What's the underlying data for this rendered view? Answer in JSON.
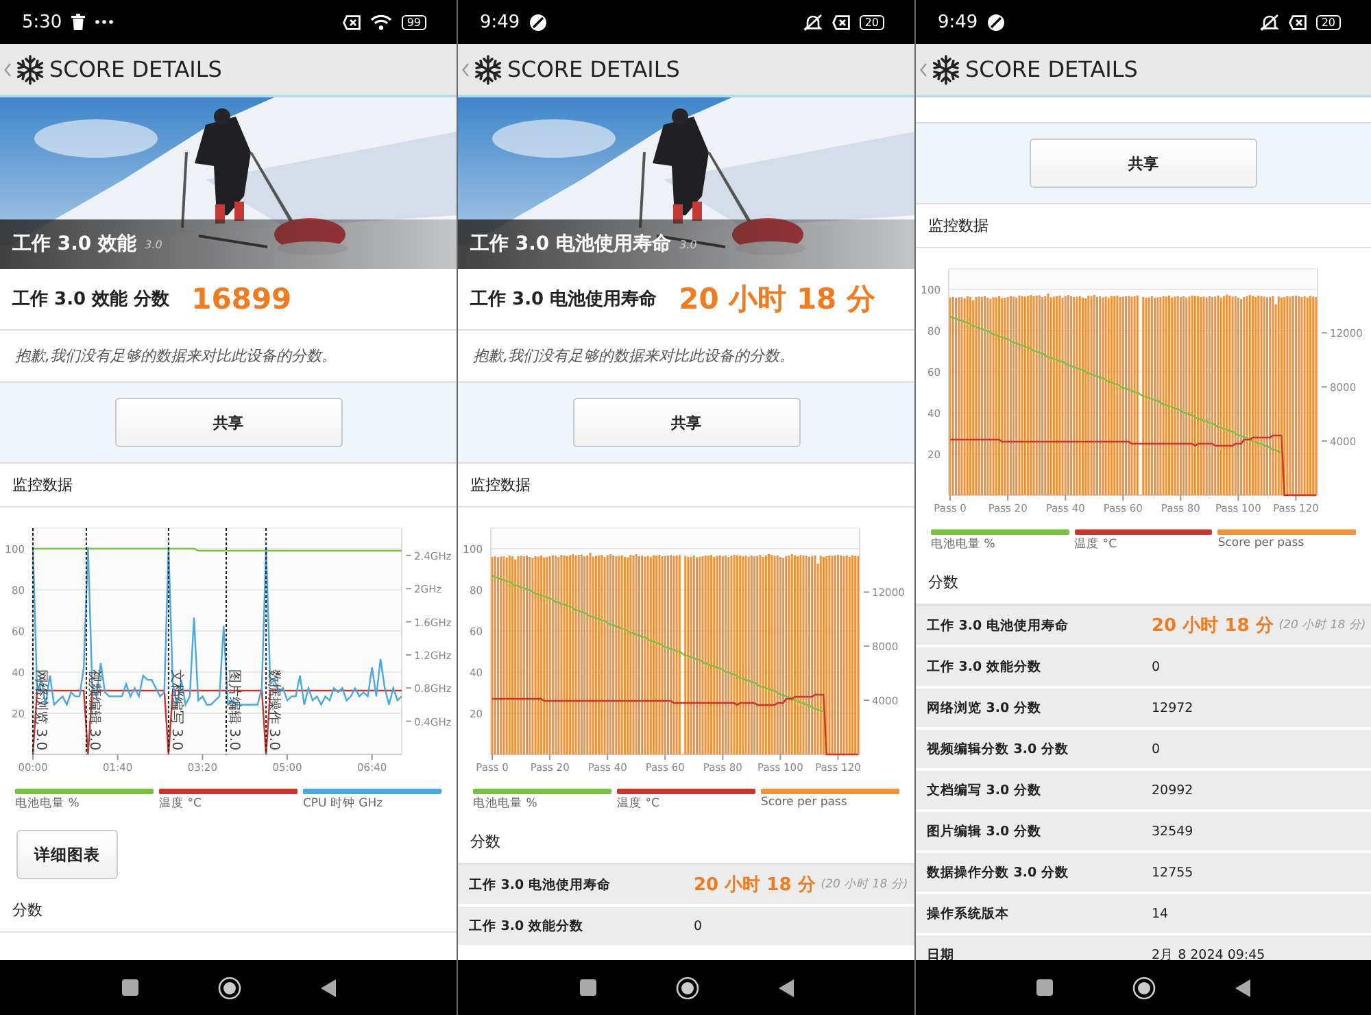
{
  "screens": [
    {
      "status_bar": {
        "time": "5:30",
        "battery": "99",
        "left_icons": [
          {
            "kind": "trash"
          },
          {
            "kind": "more"
          }
        ],
        "right_icons": [
          {
            "kind": "x-box"
          },
          {
            "kind": "wifi"
          }
        ]
      },
      "title": "SCORE DETAILS",
      "scrolled": false,
      "sections": [
        {
          "kind": "hero",
          "title": "工作 3.0 效能",
          "version": "3.0"
        },
        {
          "kind": "score",
          "label": "工作 3.0 效能 分数",
          "value": "16899"
        },
        {
          "kind": "note",
          "text": "抱歉,我们没有足够的数据来对比此设备的分数。"
        },
        {
          "kind": "share",
          "label": "共享"
        },
        {
          "kind": "heading",
          "text": "监控数据"
        },
        {
          "kind": "chart",
          "chart_data": {
            "type": "line",
            "grid": true,
            "xlim": [
              0,
              435
            ],
            "ylim": [
              0,
              110
            ],
            "y2lim": [
              0,
              2.73
            ],
            "x": [
              0,
              5,
              10,
              15,
              20,
              25,
              30,
              35,
              40,
              45,
              50,
              55,
              60,
              65,
              70,
              75,
              80,
              85,
              90,
              95,
              100,
              105,
              110,
              115,
              120,
              125,
              130,
              135,
              140,
              145,
              150,
              155,
              160,
              165,
              170,
              175,
              180,
              185,
              190,
              195,
              200,
              205,
              210,
              215,
              220,
              225,
              230,
              235,
              240,
              245,
              250,
              255,
              260,
              265,
              270,
              275,
              280,
              285,
              290,
              295,
              300,
              305,
              310,
              315,
              320,
              325,
              330,
              335,
              340,
              345,
              350,
              355,
              360,
              365,
              370,
              375,
              380,
              385,
              390,
              395,
              400,
              405,
              410,
              415,
              420,
              425,
              430,
              435
            ],
            "xticks": [
              {
                "value": 0,
                "label": "00:00"
              },
              {
                "value": 100,
                "label": "01:40"
              },
              {
                "value": 200,
                "label": "03:20"
              },
              {
                "value": 300,
                "label": "05:00"
              },
              {
                "value": 400,
                "label": "06:40"
              }
            ],
            "yticks": [
              20,
              40,
              60,
              80,
              100
            ],
            "y2ticks": [
              {
                "value": 0.4,
                "label": "0.4GHz"
              },
              {
                "value": 0.8,
                "label": "0.8GHz"
              },
              {
                "value": 1.2,
                "label": "1.2GHz"
              },
              {
                "value": 1.6,
                "label": "1.6GHz"
              },
              {
                "value": 2,
                "label": "2GHz"
              },
              {
                "value": 2.4,
                "label": "2.4GHz"
              }
            ],
            "series": [
              {
                "name": "电池电量 %",
                "color": "#7ac143",
                "values": [
                  100,
                  100,
                  100,
                  100,
                  100,
                  100,
                  100,
                  100,
                  100,
                  100,
                  100,
                  100,
                  100,
                  100,
                  100,
                  100,
                  100,
                  100,
                  100,
                  100,
                  100,
                  100,
                  100,
                  100,
                  100,
                  100,
                  100,
                  100,
                  100,
                  100,
                  100,
                  100,
                  100,
                  100,
                  100,
                  100,
                  100,
                  100,
                  100,
                  99,
                  99,
                  99,
                  99,
                  99,
                  99,
                  99,
                  99,
                  99,
                  99,
                  99,
                  99,
                  99,
                  99,
                  99,
                  99,
                  99,
                  99,
                  99,
                  99,
                  99,
                  99,
                  99,
                  99,
                  99,
                  99,
                  99,
                  99,
                  99,
                  99,
                  99,
                  99,
                  99,
                  99,
                  99,
                  99,
                  99,
                  99,
                  99,
                  99,
                  99,
                  99,
                  99,
                  99,
                  99,
                  99,
                  99,
                  99,
                  99
                ]
              },
              {
                "name": "温度 °C",
                "color": "#c8372d",
                "values": [
                  0,
                  31,
                  31,
                  31,
                  31,
                  31,
                  31,
                  31,
                  31,
                  31,
                  31,
                  31,
                  31,
                  0,
                  31,
                  31,
                  31,
                  31,
                  31,
                  31,
                  31,
                  31,
                  31,
                  31,
                  31,
                  31,
                  31,
                  31,
                  31,
                  31,
                  31,
                  31,
                  0,
                  31,
                  31,
                  31,
                  31,
                  31,
                  31,
                  31,
                  31,
                  31,
                  31,
                  31,
                  31,
                  31,
                  31,
                  31,
                  31,
                  31,
                  31,
                  31,
                  31,
                  31,
                  31,
                  0,
                  31,
                  31,
                  31,
                  31,
                  31,
                  31,
                  31,
                  31,
                  31,
                  31,
                  31,
                  31,
                  31,
                  31,
                  31,
                  31,
                  31,
                  31,
                  31,
                  31,
                  31,
                  31,
                  31,
                  31,
                  31,
                  31,
                  31,
                  31,
                  31,
                  31,
                  31,
                  31
                ]
              },
              {
                "name": "CPU 时钟 GHz",
                "color": "#4aa8e0",
                "axis": "y2",
                "values": [
                  2.5,
                  0.75,
                  0.9,
                  0.6,
                  0.95,
                  0.6,
                  0.65,
                  0.7,
                  0.6,
                  0.75,
                  0.7,
                  0.7,
                  1.05,
                  2.5,
                  0.8,
                  0.7,
                  1.1,
                  0.75,
                  0.7,
                  0.7,
                  0.7,
                  0.7,
                  0.85,
                  0.7,
                  0.8,
                  0.7,
                  0.95,
                  0.9,
                  0.9,
                  0.8,
                  0.7,
                  0.75,
                  2.5,
                  0.85,
                  0.6,
                  0.9,
                  0.6,
                  0.7,
                  1.65,
                  0.65,
                  0.7,
                  0.6,
                  0.6,
                  0.65,
                  0.7,
                  1.55,
                  0.6,
                  0.65,
                  0.6,
                  0.6,
                  0.6,
                  0.6,
                  0.6,
                  0.6,
                  0.8,
                  2.5,
                  0.85,
                  0.9,
                  0.75,
                  0.8,
                  0.65,
                  0.7,
                  0.7,
                  0.95,
                  0.6,
                  0.8,
                  0.65,
                  0.7,
                  0.6,
                  0.7,
                  0.65,
                  0.8,
                  0.75,
                  0.8,
                  0.65,
                  0.7,
                  0.8,
                  0.7,
                  0.75,
                  0.7,
                  1.05,
                  0.7,
                  1.15,
                  0.8,
                  0.6,
                  0.8,
                  0.65,
                  0.7
                ]
              }
            ],
            "annotations": [
              {
                "x": 0,
                "text": "网络浏览 3.0"
              },
              {
                "x": 63,
                "text": "视频编辑 3.0"
              },
              {
                "x": 160,
                "text": "文档编写 3.0"
              },
              {
                "x": 228,
                "text": "图片编辑 3.0"
              },
              {
                "x": 275,
                "text": "数据操作 3.0"
              }
            ]
          }
        },
        {
          "kind": "button",
          "label": "详细图表"
        },
        {
          "kind": "heading",
          "text": "分数"
        }
      ]
    },
    {
      "status_bar": {
        "time": "9:49",
        "battery": "20",
        "left_icons": [
          {
            "kind": "dnd"
          }
        ],
        "right_icons": [
          {
            "kind": "bell-off"
          },
          {
            "kind": "x-box"
          }
        ]
      },
      "title": "SCORE DETAILS",
      "scrolled": false,
      "sections": [
        {
          "kind": "hero",
          "title": "工作 3.0 电池使用寿命",
          "version": "3.0"
        },
        {
          "kind": "score",
          "label": "工作 3.0 电池使用寿命",
          "value": "20 小时 18 分"
        },
        {
          "kind": "note",
          "text": "抱歉,我们没有足够的数据来对比此设备的分数。"
        },
        {
          "kind": "share",
          "label": "共享"
        },
        {
          "kind": "heading",
          "text": "监控数据"
        },
        {
          "kind": "chart",
          "chart_data": {
            "type": "bar",
            "grid": true,
            "ylim": [
              0,
              110
            ],
            "y2lim": [
              0,
              16730
            ],
            "categories": [
              "Pass 0",
              null,
              null,
              null,
              null,
              null,
              null,
              null,
              null,
              null,
              null,
              null,
              null,
              null,
              null,
              null,
              null,
              null,
              null,
              null,
              "Pass 20",
              null,
              null,
              null,
              null,
              null,
              null,
              null,
              null,
              null,
              null,
              null,
              null,
              null,
              null,
              null,
              null,
              null,
              null,
              null,
              "Pass 40",
              null,
              null,
              null,
              null,
              null,
              null,
              null,
              null,
              null,
              null,
              null,
              null,
              null,
              null,
              null,
              null,
              null,
              null,
              null,
              "Pass 60",
              null,
              null,
              null,
              null,
              null,
              null,
              null,
              null,
              null,
              null,
              null,
              null,
              null,
              null,
              null,
              null,
              null,
              null,
              null,
              "Pass 80",
              null,
              null,
              null,
              null,
              null,
              null,
              null,
              null,
              null,
              null,
              null,
              null,
              null,
              null,
              null,
              null,
              null,
              null,
              null,
              "Pass 100",
              null,
              null,
              null,
              null,
              null,
              null,
              null,
              null,
              null,
              null,
              null,
              null,
              null,
              null,
              null,
              null,
              null,
              null,
              null,
              "Pass 120",
              null,
              null,
              null,
              null,
              null,
              null,
              null
            ],
            "yticks": [
              20,
              40,
              60,
              80,
              100
            ],
            "y2ticks": [
              4000,
              8000,
              12000
            ],
            "series": [
              {
                "name": "电池电量 %",
                "color": "#7ac143",
                "type": "line",
                "values": [
                  87,
                  86,
                  86,
                  85,
                  85,
                  84,
                  84,
                  83,
                  82,
                  82,
                  81,
                  81,
                  80,
                  80,
                  79,
                  78,
                  78,
                  77,
                  77,
                  76,
                  76,
                  75,
                  74,
                  74,
                  73,
                  73,
                  72,
                  72,
                  71,
                  70,
                  70,
                  69,
                  69,
                  68,
                  67,
                  67,
                  66,
                  66,
                  65,
                  65,
                  64,
                  63,
                  63,
                  62,
                  62,
                  61,
                  61,
                  60,
                  59,
                  59,
                  58,
                  58,
                  57,
                  57,
                  56,
                  55,
                  55,
                  54,
                  54,
                  53,
                  52,
                  52,
                  51,
                  51,
                  50,
                  50,
                  49,
                  48,
                  48,
                  47,
                  47,
                  46,
                  46,
                  45,
                  44,
                  44,
                  43,
                  43,
                  42,
                  42,
                  41,
                  40,
                  40,
                  39,
                  39,
                  38,
                  37,
                  37,
                  36,
                  36,
                  35,
                  35,
                  34,
                  33,
                  33,
                  32,
                  32,
                  31,
                  31,
                  30,
                  29,
                  29,
                  28,
                  28,
                  27,
                  26,
                  26,
                  25,
                  25,
                  24,
                  24,
                  23,
                  22,
                  22,
                  21,
                  21,
                  null,
                  null,
                  null,
                  null,
                  null,
                  null,
                  null,
                  null,
                  null,
                  null,
                  null,
                  null
                ]
              },
              {
                "name": "温度 °C",
                "color": "#c8372d",
                "type": "line",
                "values": [
                  27,
                  27,
                  27,
                  27,
                  27,
                  27,
                  27,
                  27,
                  27,
                  27,
                  27,
                  27,
                  27,
                  27,
                  27,
                  27,
                  27,
                  27,
                  26,
                  26,
                  26,
                  26,
                  26,
                  26,
                  26,
                  26,
                  26,
                  26,
                  26,
                  26,
                  26,
                  26,
                  26,
                  26,
                  26,
                  26,
                  26,
                  26,
                  26,
                  26,
                  26,
                  26,
                  26,
                  26,
                  26,
                  26,
                  26,
                  26,
                  26,
                  26,
                  26,
                  26,
                  26,
                  26,
                  26,
                  26,
                  26,
                  26,
                  26,
                  26,
                  26,
                  26,
                  26,
                  25,
                  25,
                  25,
                  25,
                  25,
                  25,
                  25,
                  25,
                  25,
                  25,
                  25,
                  25,
                  25,
                  25,
                  25,
                  25,
                  25,
                  25,
                  25,
                  25,
                  25,
                  25,
                  24,
                  25,
                  25,
                  25,
                  25,
                  25,
                  25,
                  24,
                  24,
                  24,
                  24,
                  24,
                  24,
                  24,
                  25,
                  25,
                  25,
                  27,
                  27,
                  27,
                  28,
                  28,
                  28,
                  28,
                  28,
                  28,
                  28,
                  29,
                  29,
                  29,
                  29,
                  0,
                  0,
                  0,
                  0,
                  0,
                  0,
                  0,
                  0,
                  0,
                  0,
                  0,
                  0
                ]
              },
              {
                "name": "Score per pass",
                "color": "#f0923c",
                "type": "bar",
                "axis": "y2",
                "values": [
                  14600,
                  14650,
                  14580,
                  14620,
                  14640,
                  14560,
                  14700,
                  14650,
                  14400,
                  14660,
                  14680,
                  14650,
                  14700,
                  14600,
                  14520,
                  14650,
                  14620,
                  14700,
                  14560,
                  14600,
                  14650,
                  14720,
                  14680,
                  14600,
                  14750,
                  14700,
                  14680,
                  14720,
                  14800,
                  14700,
                  14750,
                  14780,
                  14650,
                  14700,
                  14900,
                  14620,
                  14680,
                  14700,
                  14750,
                  14600,
                  14720,
                  14800,
                  14700,
                  14650,
                  14680,
                  14720,
                  14600,
                  14550,
                  14750,
                  14700,
                  14800,
                  14650,
                  14700,
                  14620,
                  14680,
                  14600,
                  14720,
                  14700,
                  14750,
                  14650,
                  14680,
                  14700,
                  14720,
                  14680,
                  14700,
                  14750,
                  null,
                  14650,
                  14600,
                  14620,
                  14700,
                  14580,
                  14620,
                  14650,
                  14700,
                  14680,
                  14750,
                  14600,
                  14680,
                  14720,
                  14650,
                  14700,
                  14600,
                  14680,
                  14750,
                  14720,
                  14700,
                  14650,
                  14680,
                  14620,
                  14700,
                  14650,
                  14680,
                  14750,
                  14600,
                  14700,
                  14820,
                  14750,
                  14680,
                  14720,
                  14600,
                  14500,
                  14650,
                  14700,
                  14800,
                  14720,
                  14650,
                  14750,
                  14700,
                  14680,
                  14620,
                  14650,
                  14700,
                  14100,
                  14680,
                  14600,
                  14650,
                  14700,
                  14680,
                  14720,
                  14750,
                  14700,
                  14650,
                  14700,
                  14600,
                  14720,
                  14680,
                  14650
                ]
              }
            ]
          }
        },
        {
          "kind": "heading",
          "text": "分数"
        },
        {
          "kind": "table",
          "rows": [
            {
              "label": "工作 3.0 电池使用寿命",
              "value": "20 小时 18 分",
              "note": "(20 小时 18 分)",
              "emphasis": true
            },
            {
              "label": "工作 3.0 效能分数",
              "value": "0",
              "emphasis": false
            }
          ]
        }
      ]
    },
    {
      "status_bar": {
        "time": "9:49",
        "battery": "20",
        "left_icons": [
          {
            "kind": "dnd"
          }
        ],
        "right_icons": [
          {
            "kind": "bell-off"
          },
          {
            "kind": "x-box"
          }
        ]
      },
      "title": "SCORE DETAILS",
      "scrolled": true,
      "sections": [
        {
          "kind": "share",
          "label": "共享"
        },
        {
          "kind": "heading",
          "text": "监控数据"
        },
        {
          "kind": "chart",
          "chart_data": {
            "type": "bar",
            "grid": true,
            "ylim": [
              0,
              110
            ],
            "y2lim": [
              0,
              16730
            ],
            "categories": [
              "Pass 0",
              null,
              null,
              null,
              null,
              null,
              null,
              null,
              null,
              null,
              null,
              null,
              null,
              null,
              null,
              null,
              null,
              null,
              null,
              null,
              "Pass 20",
              null,
              null,
              null,
              null,
              null,
              null,
              null,
              null,
              null,
              null,
              null,
              null,
              null,
              null,
              null,
              null,
              null,
              null,
              null,
              "Pass 40",
              null,
              null,
              null,
              null,
              null,
              null,
              null,
              null,
              null,
              null,
              null,
              null,
              null,
              null,
              null,
              null,
              null,
              null,
              null,
              "Pass 60",
              null,
              null,
              null,
              null,
              null,
              null,
              null,
              null,
              null,
              null,
              null,
              null,
              null,
              null,
              null,
              null,
              null,
              null,
              null,
              "Pass 80",
              null,
              null,
              null,
              null,
              null,
              null,
              null,
              null,
              null,
              null,
              null,
              null,
              null,
              null,
              null,
              null,
              null,
              null,
              null,
              "Pass 100",
              null,
              null,
              null,
              null,
              null,
              null,
              null,
              null,
              null,
              null,
              null,
              null,
              null,
              null,
              null,
              null,
              null,
              null,
              null,
              "Pass 120",
              null,
              null,
              null,
              null,
              null,
              null,
              null
            ],
            "yticks": [
              20,
              40,
              60,
              80,
              100
            ],
            "y2ticks": [
              4000,
              8000,
              12000
            ],
            "series": [
              {
                "name": "电池电量 %",
                "color": "#7ac143",
                "type": "line",
                "values": [
                  87,
                  86,
                  86,
                  85,
                  85,
                  84,
                  84,
                  83,
                  82,
                  82,
                  81,
                  81,
                  80,
                  80,
                  79,
                  78,
                  78,
                  77,
                  77,
                  76,
                  76,
                  75,
                  74,
                  74,
                  73,
                  73,
                  72,
                  72,
                  71,
                  70,
                  70,
                  69,
                  69,
                  68,
                  67,
                  67,
                  66,
                  66,
                  65,
                  65,
                  64,
                  63,
                  63,
                  62,
                  62,
                  61,
                  61,
                  60,
                  59,
                  59,
                  58,
                  58,
                  57,
                  57,
                  56,
                  55,
                  55,
                  54,
                  54,
                  53,
                  52,
                  52,
                  51,
                  51,
                  50,
                  50,
                  49,
                  48,
                  48,
                  47,
                  47,
                  46,
                  46,
                  45,
                  44,
                  44,
                  43,
                  43,
                  42,
                  42,
                  41,
                  40,
                  40,
                  39,
                  39,
                  38,
                  37,
                  37,
                  36,
                  36,
                  35,
                  35,
                  34,
                  33,
                  33,
                  32,
                  32,
                  31,
                  31,
                  30,
                  29,
                  29,
                  28,
                  28,
                  27,
                  26,
                  26,
                  25,
                  25,
                  24,
                  24,
                  23,
                  22,
                  22,
                  21,
                  21,
                  null,
                  null,
                  null,
                  null,
                  null,
                  null,
                  null,
                  null,
                  null,
                  null,
                  null,
                  null
                ]
              },
              {
                "name": "温度 °C",
                "color": "#c8372d",
                "type": "line",
                "values": [
                  27,
                  27,
                  27,
                  27,
                  27,
                  27,
                  27,
                  27,
                  27,
                  27,
                  27,
                  27,
                  27,
                  27,
                  27,
                  27,
                  27,
                  27,
                  26,
                  26,
                  26,
                  26,
                  26,
                  26,
                  26,
                  26,
                  26,
                  26,
                  26,
                  26,
                  26,
                  26,
                  26,
                  26,
                  26,
                  26,
                  26,
                  26,
                  26,
                  26,
                  26,
                  26,
                  26,
                  26,
                  26,
                  26,
                  26,
                  26,
                  26,
                  26,
                  26,
                  26,
                  26,
                  26,
                  26,
                  26,
                  26,
                  26,
                  26,
                  26,
                  26,
                  26,
                  26,
                  25,
                  25,
                  25,
                  25,
                  25,
                  25,
                  25,
                  25,
                  25,
                  25,
                  25,
                  25,
                  25,
                  25,
                  25,
                  25,
                  25,
                  25,
                  25,
                  25,
                  25,
                  25,
                  24,
                  25,
                  25,
                  25,
                  25,
                  25,
                  25,
                  24,
                  24,
                  24,
                  24,
                  24,
                  24,
                  24,
                  25,
                  25,
                  25,
                  27,
                  27,
                  27,
                  28,
                  28,
                  28,
                  28,
                  28,
                  28,
                  28,
                  29,
                  29,
                  29,
                  29,
                  0,
                  0,
                  0,
                  0,
                  0,
                  0,
                  0,
                  0,
                  0,
                  0,
                  0,
                  0
                ]
              },
              {
                "name": "Score per pass",
                "color": "#f0923c",
                "type": "bar",
                "axis": "y2",
                "values": [
                  14600,
                  14650,
                  14580,
                  14620,
                  14640,
                  14560,
                  14700,
                  14650,
                  14400,
                  14660,
                  14680,
                  14650,
                  14700,
                  14600,
                  14520,
                  14650,
                  14620,
                  14700,
                  14560,
                  14600,
                  14650,
                  14720,
                  14680,
                  14600,
                  14750,
                  14700,
                  14680,
                  14720,
                  14800,
                  14700,
                  14750,
                  14780,
                  14650,
                  14700,
                  14900,
                  14620,
                  14680,
                  14700,
                  14750,
                  14600,
                  14720,
                  14800,
                  14700,
                  14650,
                  14680,
                  14720,
                  14600,
                  14550,
                  14750,
                  14700,
                  14800,
                  14650,
                  14700,
                  14620,
                  14680,
                  14600,
                  14720,
                  14700,
                  14750,
                  14650,
                  14680,
                  14700,
                  14720,
                  14680,
                  14700,
                  14750,
                  null,
                  14650,
                  14600,
                  14620,
                  14700,
                  14580,
                  14620,
                  14650,
                  14700,
                  14680,
                  14750,
                  14600,
                  14680,
                  14720,
                  14650,
                  14700,
                  14600,
                  14680,
                  14750,
                  14720,
                  14700,
                  14650,
                  14680,
                  14620,
                  14700,
                  14650,
                  14680,
                  14750,
                  14600,
                  14700,
                  14820,
                  14750,
                  14680,
                  14720,
                  14600,
                  14500,
                  14650,
                  14700,
                  14800,
                  14720,
                  14650,
                  14750,
                  14700,
                  14680,
                  14620,
                  14650,
                  14700,
                  14100,
                  14680,
                  14600,
                  14650,
                  14700,
                  14680,
                  14720,
                  14750,
                  14700,
                  14650,
                  14700,
                  14600,
                  14720,
                  14680,
                  14650
                ]
              }
            ]
          }
        },
        {
          "kind": "heading",
          "text": "分数"
        },
        {
          "kind": "table",
          "rows": [
            {
              "label": "工作 3.0 电池使用寿命",
              "value": "20 小时 18 分",
              "note": "(20 小时 18 分)",
              "emphasis": true
            },
            {
              "label": "工作 3.0 效能分数",
              "value": "0",
              "emphasis": false
            },
            {
              "label": "网络浏览 3.0 分数",
              "value": "12972",
              "emphasis": false
            },
            {
              "label": "视频编辑分数 3.0 分数",
              "value": "0",
              "emphasis": false
            },
            {
              "label": "文档编写 3.0 分数",
              "value": "20992",
              "emphasis": false
            },
            {
              "label": "图片编辑 3.0 分数",
              "value": "32549",
              "emphasis": false
            },
            {
              "label": "数据操作分数 3.0 分数",
              "value": "12755",
              "emphasis": false
            },
            {
              "label": "操作系统版本",
              "value": "14",
              "emphasis": false
            },
            {
              "label": "日期",
              "value": "2月 8 2024 09:45",
              "emphasis": false
            }
          ]
        }
      ]
    }
  ]
}
